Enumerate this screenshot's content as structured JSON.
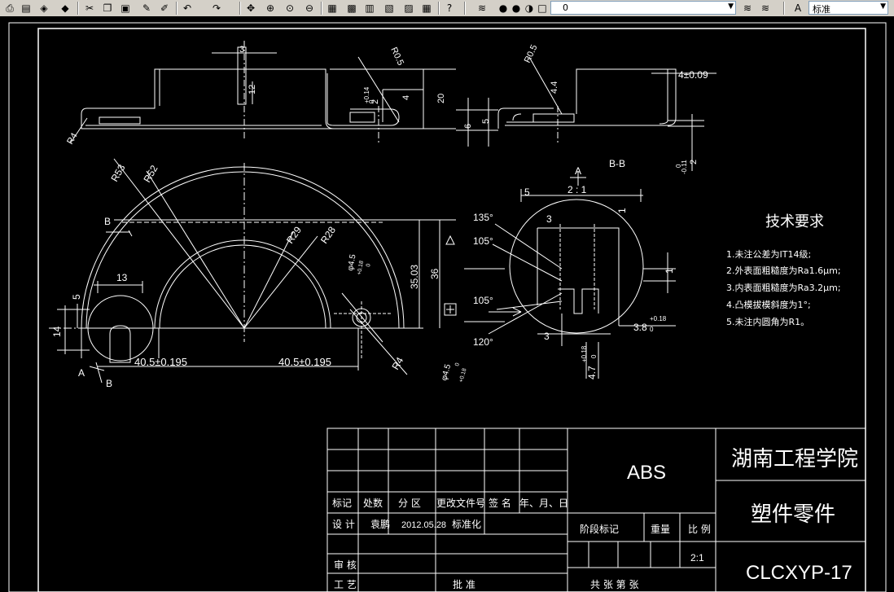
{
  "toolbar": {
    "icons": [
      "plot-icon",
      "plot-preview-icon",
      "publish-icon",
      "3d-dwf-icon",
      "cut-icon",
      "copy-icon",
      "paste-icon",
      "match-properties-icon",
      "block-editor-icon",
      "undo-icon",
      "redo-icon",
      "pan-icon",
      "zoom-realtime-icon",
      "zoom-window-icon",
      "zoom-previous-icon",
      "properties-icon",
      "design-center-icon",
      "tool-palettes-icon",
      "sheet-set-icon",
      "markup-icon",
      "quickcalc-icon",
      "help-icon",
      "layer-manager-icon",
      "layer-previous-icon",
      "layer-state-icon"
    ],
    "layer_value": "0",
    "text_style_value": "标准"
  },
  "drawing": {
    "dims_top": {
      "d3": "3",
      "d12": "12",
      "r05a": "R0.5",
      "tol_014": "+0.14",
      "tol_0": "0",
      "d2": "2",
      "d4": "4",
      "d20": "20",
      "r4": "R4",
      "d6": "6",
      "d5": "5",
      "r05b": "R0.5",
      "d44": "4.4",
      "d4tol": "4±0.09",
      "tol_011": "-0.11",
      "tol2_0": "0",
      "d2b": "2"
    },
    "dims_main": {
      "r53": "R53",
      "r52": "R52",
      "r29": "R29",
      "r28": "R28",
      "b_upper": "B",
      "b_lower": "B",
      "a_label": "A",
      "d13": "13",
      "d5": "5",
      "d14": "14",
      "d3503": "35.03",
      "d36": "36",
      "r4": "R4",
      "phi_top": "φ4.5",
      "phi_top_tol": "+0.18",
      "phi_top_tol0": "0",
      "phi_bot": "φ4.5",
      "phi_bot_tol": "+0.18",
      "phi_bot_tol0": "0",
      "d405a": "40.5±0.195",
      "d405b": "40.5±0.195"
    },
    "detail": {
      "label_a": "A",
      "scale": "2 : 1",
      "label_bb": "B-B",
      "d5": "5",
      "d1a": "1",
      "d3a": "3",
      "d1b": "1",
      "d3b": "3",
      "a135": "135°",
      "a105a": "105°",
      "a105b": "105°",
      "a120": "120°",
      "d38": "3.8",
      "d38tol": "+0.18",
      "d38tol0": "0",
      "d47": "4.7",
      "d47tol": "+0.18",
      "d47tol0": "0"
    },
    "notes": {
      "title": "技术要求",
      "items": [
        "1.未注公差为IT14级;",
        "2.外表面粗糙度为Ra1.6μm;",
        "3.内表面粗糙度为Ra3.2μm;",
        "4.凸模拔模斜度为1°;",
        "5.未注内圆角为R1。"
      ]
    },
    "title_block": {
      "row_headers": [
        "标记",
        "处数",
        "分 区",
        "更改文件号",
        "签 名",
        "年、月、日"
      ],
      "design_label": "设 计",
      "designer": "袁鹏",
      "date": "2012.05.28",
      "standardize": "标准化",
      "review": "审 核",
      "process": "工 艺",
      "approve": "批 准",
      "material": "ABS",
      "stage_mark": "阶段标记",
      "weight": "重量",
      "scale_label": "比 例",
      "scale_value": "2:1",
      "sheets": "共  张  第  张",
      "school": "湖南工程学院",
      "part_name": "塑件零件",
      "drawing_no": "CLCXYP-17"
    }
  }
}
